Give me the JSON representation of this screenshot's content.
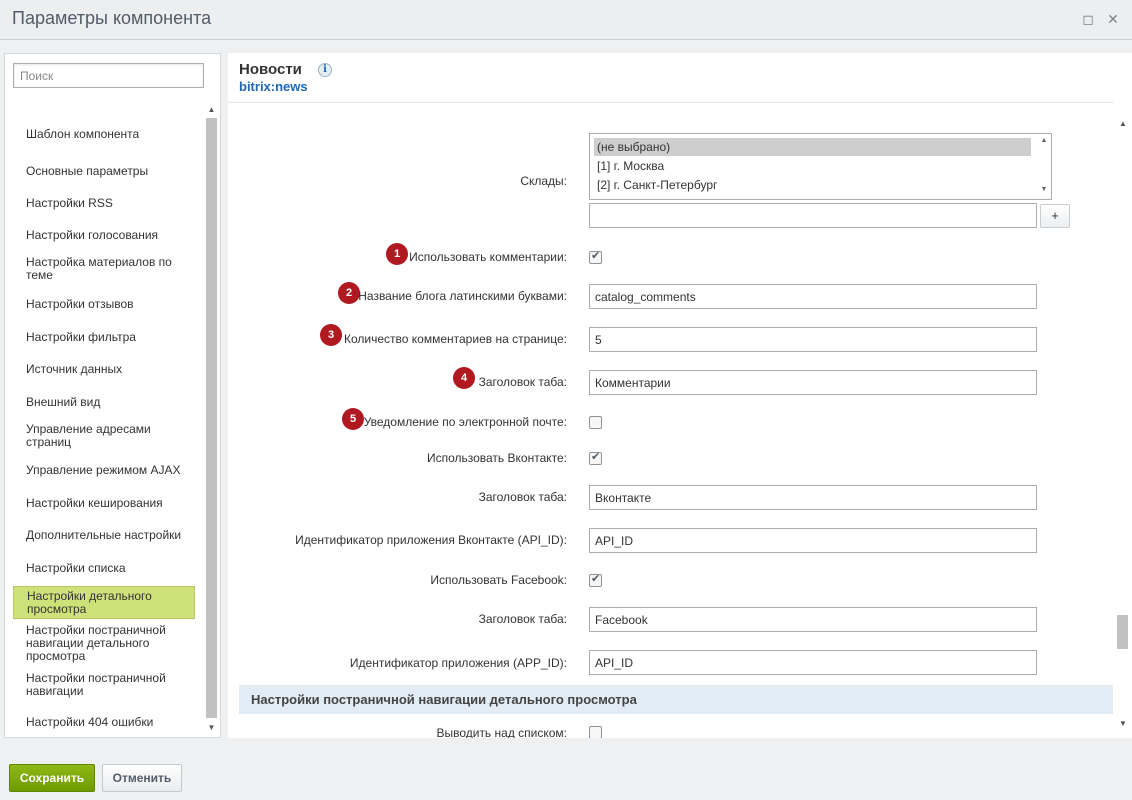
{
  "window": {
    "title": "Параметры компонента",
    "icons": {
      "maximize": "square-icon",
      "close": "close-icon"
    }
  },
  "sidebar": {
    "search_placeholder": "Поиск",
    "items": [
      {
        "label": "Шаблон компонента",
        "active": false
      },
      {
        "label": "Основные параметры",
        "active": false
      },
      {
        "label": "Настройки RSS",
        "active": false
      },
      {
        "label": "Настройки голосования",
        "active": false
      },
      {
        "label": "Настройка материалов по теме",
        "active": false
      },
      {
        "label": "Настройки отзывов",
        "active": false
      },
      {
        "label": "Настройки фильтра",
        "active": false
      },
      {
        "label": "Источник данных",
        "active": false
      },
      {
        "label": "Внешний вид",
        "active": false
      },
      {
        "label": "Управление адресами страниц",
        "active": false
      },
      {
        "label": "Управление режимом AJAX",
        "active": false
      },
      {
        "label": "Настройки кеширования",
        "active": false
      },
      {
        "label": "Дополнительные настройки",
        "active": false
      },
      {
        "label": "Настройки списка",
        "active": false
      },
      {
        "label": "Настройки детального просмотра",
        "active": true
      },
      {
        "label": "Настройки постраничной навигации детального просмотра",
        "active": false
      },
      {
        "label": "Настройки постраничной навигации",
        "active": false
      },
      {
        "label": "Настройки 404 ошибки",
        "active": false
      }
    ]
  },
  "header": {
    "title": "Новости",
    "subtitle": "bitrix:news",
    "info_icon": "i"
  },
  "form": {
    "stores_label": "Склады:",
    "stores_options": [
      "(не выбрано)",
      "[1] г. Москва",
      "[2] г. Санкт-Петербург"
    ],
    "stores_selected": "(не выбрано)",
    "add_button": "+",
    "use_comments_label": "Использовать комментарии:",
    "use_comments_checked": true,
    "blog_name_label": "Название блога латинскими буквами:",
    "blog_name_value": "catalog_comments",
    "comments_count_label": "Количество комментариев на странице:",
    "comments_count_value": "5",
    "tab_title_label": "Заголовок таба:",
    "tab_title_value": "Комментарии",
    "email_notify_label": "Уведомление по электронной почте:",
    "email_notify_checked": false,
    "use_vk_label": "Использовать Вконтакте:",
    "use_vk_checked": true,
    "vk_tab_label": "Заголовок таба:",
    "vk_tab_value": "Вконтакте",
    "vk_api_label": "Идентификатор приложения Вконтакте (API_ID):",
    "vk_api_value": "API_ID",
    "use_fb_label": "Использовать Facebook:",
    "use_fb_checked": true,
    "fb_tab_label": "Заголовок таба:",
    "fb_tab_value": "Facebook",
    "fb_app_label": "Идентификатор приложения (APP_ID):",
    "fb_app_value": "API_ID",
    "section_header": "Настройки постраничной навигации детального просмотра",
    "show_above_list_label": "Выводить над списком:",
    "show_above_list_checked": false
  },
  "badges": [
    "1",
    "2",
    "3",
    "4",
    "5"
  ],
  "footer": {
    "save_label": "Сохранить",
    "cancel_label": "Отменить"
  },
  "colors": {
    "accent_green": "#7aa60a",
    "active_item": "#cfe27a",
    "badge_red": "#b0191f",
    "link_blue": "#2067b0",
    "section_bg": "#e2ecf5"
  }
}
